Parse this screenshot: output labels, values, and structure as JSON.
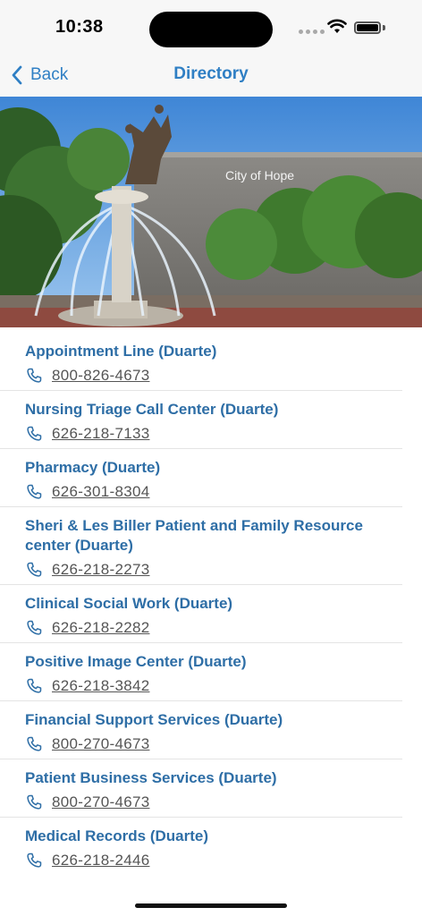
{
  "status_bar": {
    "time": "10:38"
  },
  "nav": {
    "back_label": "Back",
    "title": "Directory"
  },
  "hero": {
    "sign_text": "City of Hope"
  },
  "directory": [
    {
      "name": "Appointment Line (Duarte)",
      "phone": "800-826-4673"
    },
    {
      "name": "Nursing Triage Call Center (Duarte)",
      "phone": "626-218-7133"
    },
    {
      "name": "Pharmacy (Duarte)",
      "phone": "626-301-8304"
    },
    {
      "name": "Sheri & Les Biller Patient and Family Resource center (Duarte)",
      "phone": "626-218-2273"
    },
    {
      "name": "Clinical Social Work (Duarte)",
      "phone": "626-218-2282"
    },
    {
      "name": "Positive Image Center (Duarte)",
      "phone": "626-218-3842"
    },
    {
      "name": "Financial Support Services (Duarte)",
      "phone": "800-270-4673"
    },
    {
      "name": "Patient Business Services (Duarte)",
      "phone": "800-270-4673"
    },
    {
      "name": "Medical Records (Duarte)",
      "phone": "626-218-2446"
    }
  ],
  "colors": {
    "accent": "#2f7fc4",
    "entry_title": "#2e6ea6"
  }
}
